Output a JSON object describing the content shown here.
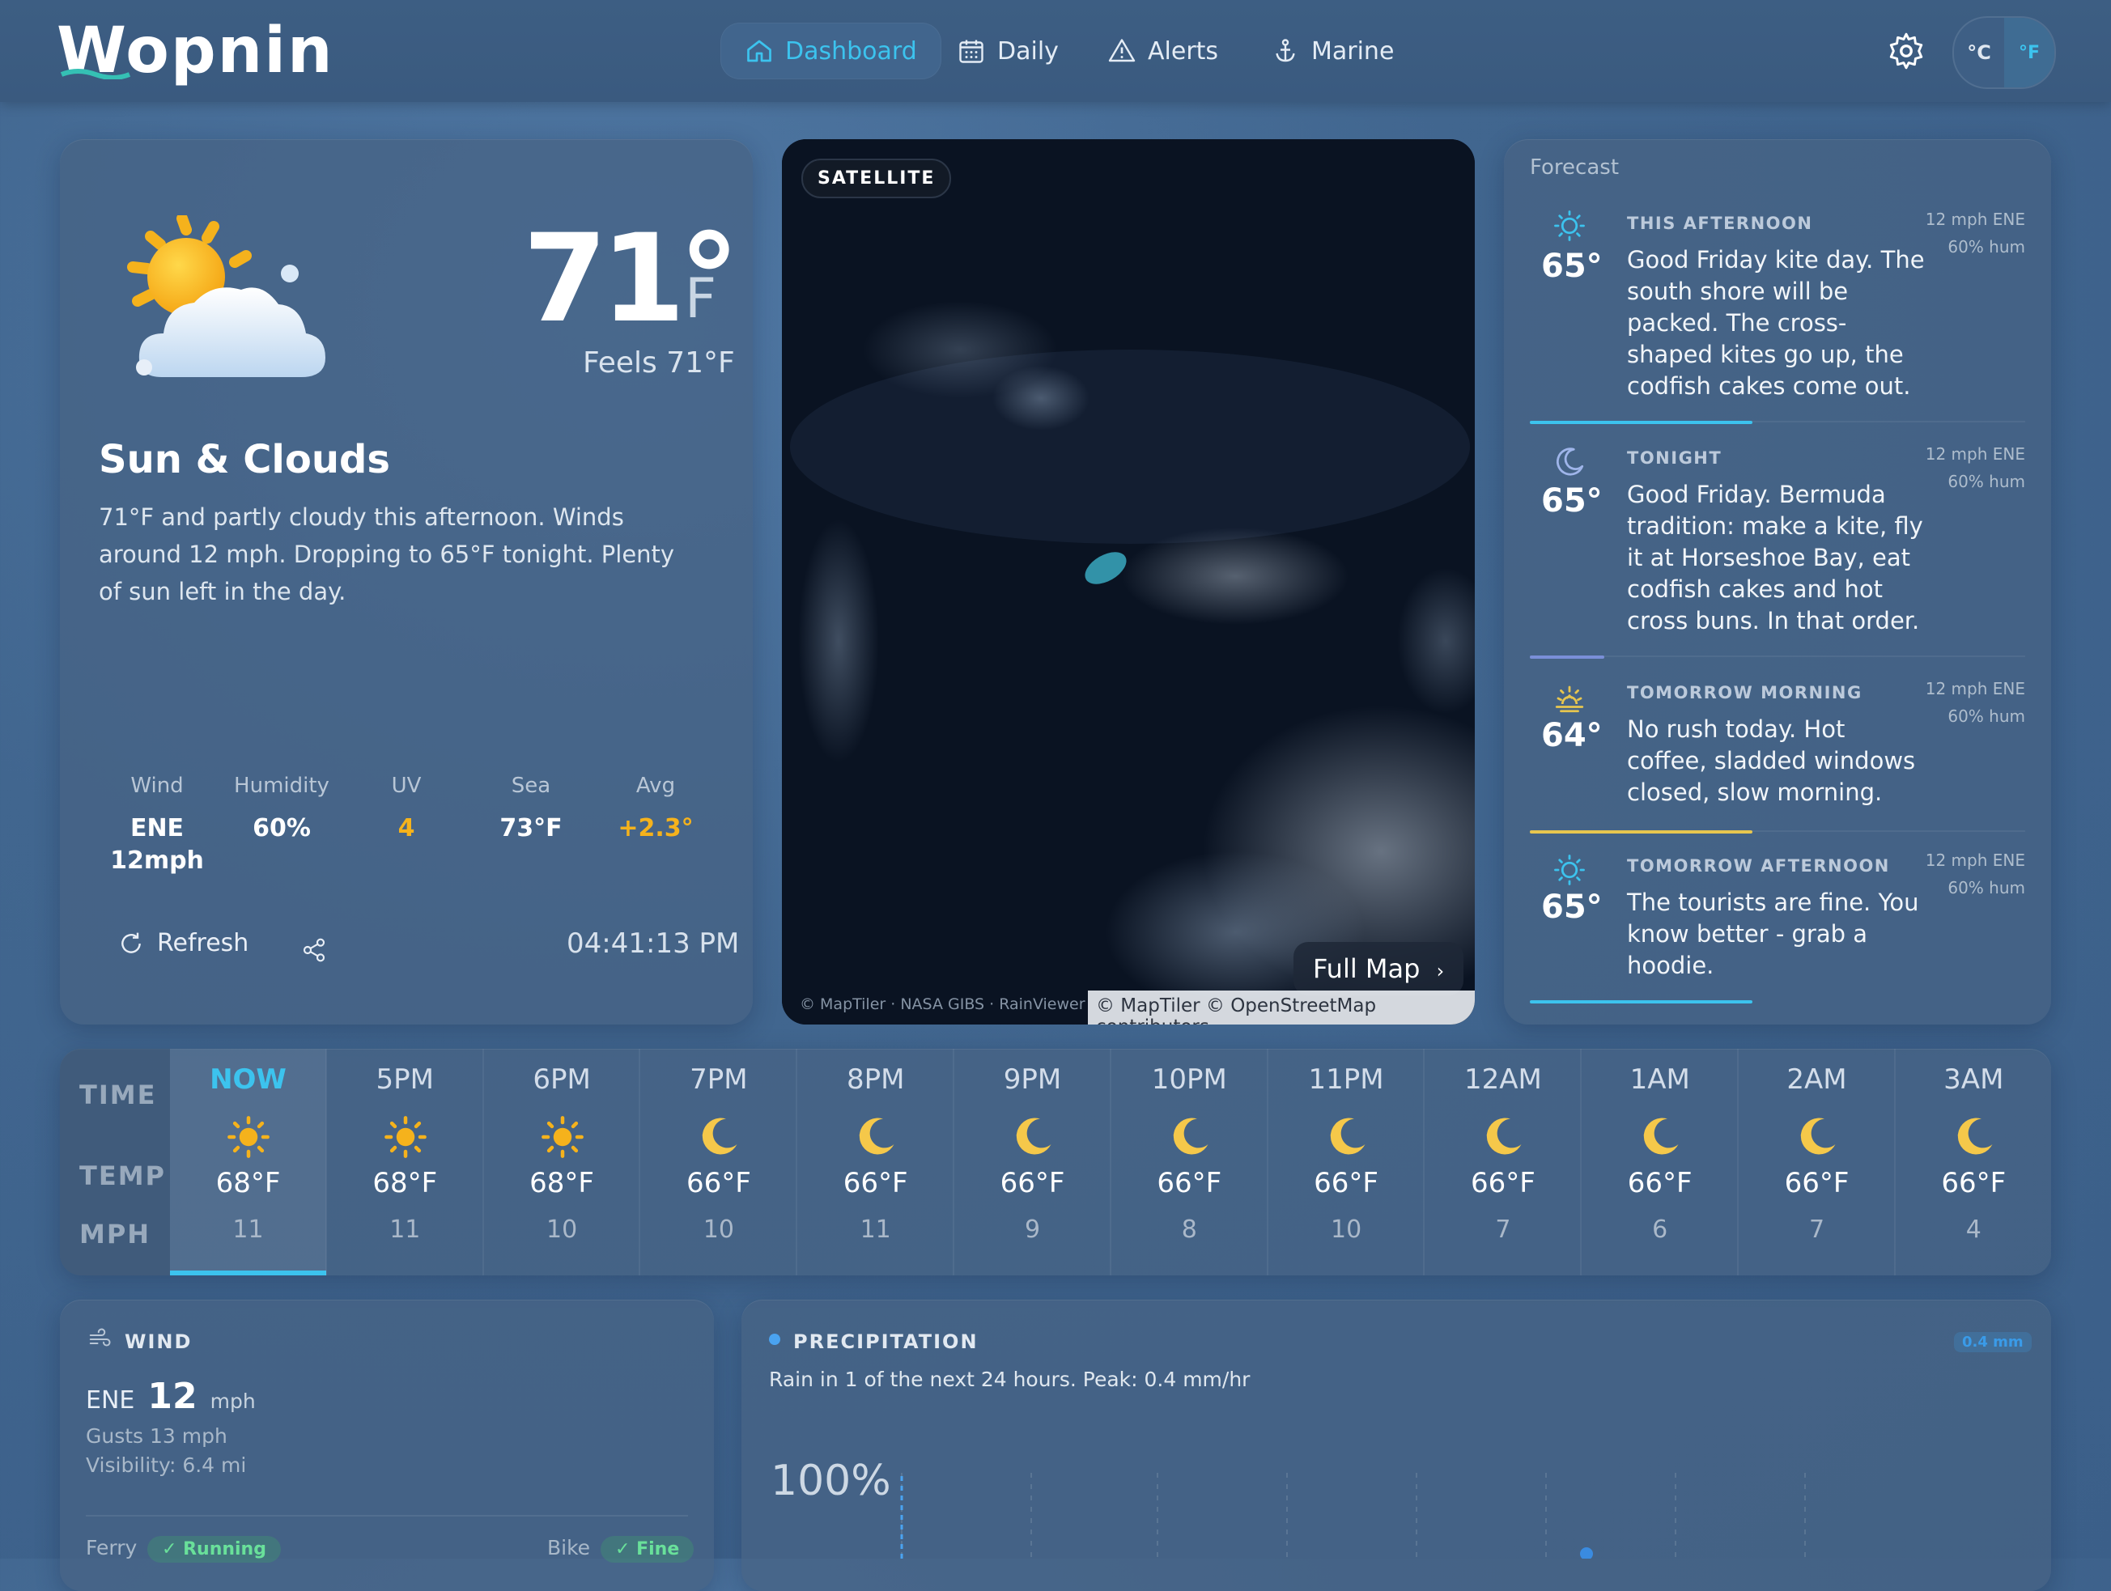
{
  "app": {
    "logo": "Wopnin"
  },
  "nav": [
    {
      "label": "Dashboard",
      "active": true,
      "icon": "home-icon"
    },
    {
      "label": "Daily",
      "active": false,
      "icon": "calendar-icon"
    },
    {
      "label": "Alerts",
      "active": false,
      "icon": "alert-icon"
    },
    {
      "label": "Marine",
      "active": false,
      "icon": "anchor-icon"
    }
  ],
  "units": {
    "c": "°C",
    "f": "°F",
    "selected": "f"
  },
  "current": {
    "temp": "71°",
    "unit": "F",
    "feels": "Feels 71°F",
    "condition": "Sun & Clouds",
    "description": "71°F and partly cloudy this afternoon. Winds around 12 mph. Dropping to 65°F tonight. Plenty of sun left in the day.",
    "stats": [
      {
        "label": "Wind",
        "value": "ENE\n12mph",
        "color": "#ffffff"
      },
      {
        "label": "Humidity",
        "value": "60%",
        "color": "#ffffff"
      },
      {
        "label": "UV",
        "value": "4",
        "color": "#f5b21c"
      },
      {
        "label": "Sea",
        "value": "73°F",
        "color": "#ffffff"
      },
      {
        "label": "Avg",
        "value": "+2.3°",
        "color": "#f5b21c"
      }
    ],
    "refresh_label": "Refresh",
    "time": "04:41:13 PM"
  },
  "satellite": {
    "badge": "SATELLITE",
    "full_map": "Full Map",
    "credit_left": "© MapTiler · NASA GIBS · RainViewer",
    "credit_right": "© MapTiler © OpenStreetMap contributors"
  },
  "forecast": {
    "title": "Forecast",
    "items": [
      {
        "period": "THIS AFTERNOON",
        "temp": "65°",
        "icon": "sun-icon",
        "text": "Good Friday kite day. The south shore will be packed. The cross-shaped kites go up, the codfish cakes come out.",
        "wind": "12 mph ENE",
        "hum": "60% hum",
        "bar_color": "#3cc3ee",
        "bar_fill": 0.45
      },
      {
        "period": "TONIGHT",
        "temp": "65°",
        "icon": "moon-icon",
        "text": "Good Friday. Bermuda tradition: make a kite, fly it at Horseshoe Bay, eat codfish cakes and hot cross buns. In that order.",
        "wind": "12 mph ENE",
        "hum": "60% hum",
        "bar_color": "#7a8fd8",
        "bar_fill": 0.15
      },
      {
        "period": "TOMORROW MORNING",
        "temp": "64°",
        "icon": "sunrise-icon",
        "text": "No rush today. Hot coffee, sladded windows closed, slow morning.",
        "wind": "12 mph ENE",
        "hum": "60% hum",
        "bar_color": "#e7c64f",
        "bar_fill": 0.45
      },
      {
        "period": "TOMORROW AFTERNOON",
        "temp": "65°",
        "icon": "sun-icon",
        "text": "The tourists are fine. You know better - grab a hoodie.",
        "wind": "12 mph ENE",
        "hum": "60% hum",
        "bar_color": "#3cc3ee",
        "bar_fill": 0.45
      }
    ]
  },
  "hourly": {
    "labels": {
      "time": "TIME",
      "temp": "TEMP",
      "mph": "MPH"
    },
    "hours": [
      {
        "time": "NOW",
        "icon": "sun",
        "temp": "68°F",
        "wind": "11"
      },
      {
        "time": "5PM",
        "icon": "sun",
        "temp": "68°F",
        "wind": "11"
      },
      {
        "time": "6PM",
        "icon": "sun",
        "temp": "68°F",
        "wind": "10"
      },
      {
        "time": "7PM",
        "icon": "moon",
        "temp": "66°F",
        "wind": "10"
      },
      {
        "time": "8PM",
        "icon": "moon",
        "temp": "66°F",
        "wind": "11"
      },
      {
        "time": "9PM",
        "icon": "moon",
        "temp": "66°F",
        "wind": "9"
      },
      {
        "time": "10PM",
        "icon": "moon",
        "temp": "66°F",
        "wind": "8"
      },
      {
        "time": "11PM",
        "icon": "moon",
        "temp": "66°F",
        "wind": "10"
      },
      {
        "time": "12AM",
        "icon": "moon",
        "temp": "66°F",
        "wind": "7"
      },
      {
        "time": "1AM",
        "icon": "moon",
        "temp": "66°F",
        "wind": "6"
      },
      {
        "time": "2AM",
        "icon": "moon",
        "temp": "66°F",
        "wind": "7"
      },
      {
        "time": "3AM",
        "icon": "moon",
        "temp": "66°F",
        "wind": "4"
      }
    ]
  },
  "wind": {
    "title": "WIND",
    "direction": "ENE",
    "speed": "12",
    "unit": "mph",
    "gusts": "Gusts 13 mph",
    "visibility": "Visibility: 6.4 mi",
    "ferry_label": "Ferry",
    "ferry_status": "✓ Running",
    "bike_label": "Bike",
    "bike_status": "✓ Fine"
  },
  "precip": {
    "title": "PRECIPITATION",
    "badge": "0.4 mm",
    "summary": "Rain in 1 of the next 24 hours. Peak: 0.4 mm/hr",
    "percent": "100%"
  }
}
